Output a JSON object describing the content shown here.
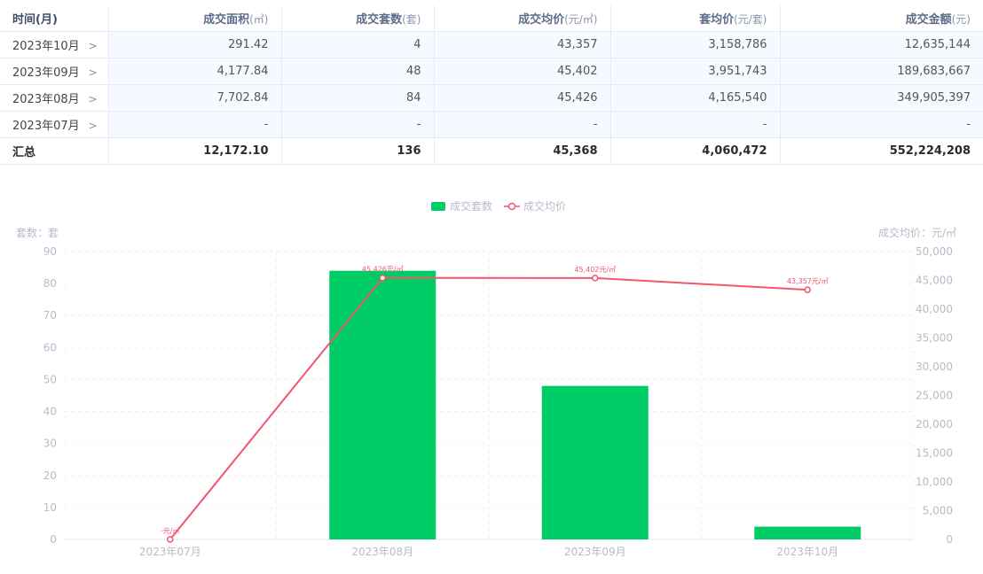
{
  "table": {
    "headers": [
      {
        "label": "时间(月)",
        "unit": ""
      },
      {
        "label": "成交面积",
        "unit": "(㎡)"
      },
      {
        "label": "成交套数",
        "unit": "(套)"
      },
      {
        "label": "成交均价",
        "unit": "(元/㎡)"
      },
      {
        "label": "套均价",
        "unit": "(元/套)"
      },
      {
        "label": "成交金额",
        "unit": "(元)"
      }
    ],
    "rows": [
      {
        "month": "2023年10月",
        "area": "291.42",
        "count": "4",
        "avg_price": "43,357",
        "unit_price": "3,158,786",
        "amount": "12,635,144"
      },
      {
        "month": "2023年09月",
        "area": "4,177.84",
        "count": "48",
        "avg_price": "45,402",
        "unit_price": "3,951,743",
        "amount": "189,683,667"
      },
      {
        "month": "2023年08月",
        "area": "7,702.84",
        "count": "84",
        "avg_price": "45,426",
        "unit_price": "4,165,540",
        "amount": "349,905,397"
      },
      {
        "month": "2023年07月",
        "area": "-",
        "count": "-",
        "avg_price": "-",
        "unit_price": "-",
        "amount": "-"
      }
    ],
    "total": {
      "label": "汇总",
      "area": "12,172.10",
      "count": "136",
      "avg_price": "45,368",
      "unit_price": "4,060,472",
      "amount": "552,224,208"
    }
  },
  "chart_data": {
    "type": "bar",
    "categories": [
      "2023年07月",
      "2023年08月",
      "2023年09月",
      "2023年10月"
    ],
    "series": [
      {
        "name": "成交套数",
        "type": "bar",
        "axis": "left",
        "values": [
          0,
          84,
          48,
          4
        ],
        "color": "#00cc66"
      },
      {
        "name": "成交均价",
        "type": "line",
        "axis": "right",
        "values": [
          0,
          45426,
          45402,
          43357
        ],
        "color": "#f0566e",
        "data_labels": [
          "-元/㎡",
          "45,426元/㎡",
          "45,402元/㎡",
          "43,357元/㎡"
        ]
      }
    ],
    "left_axis": {
      "label": "套数：套",
      "min": 0,
      "max": 90,
      "step": 10
    },
    "right_axis": {
      "label": "成交均价：元/㎡",
      "min": 0,
      "max": 50000,
      "step": 5000
    },
    "legend_position": "top-center",
    "grid": true
  }
}
